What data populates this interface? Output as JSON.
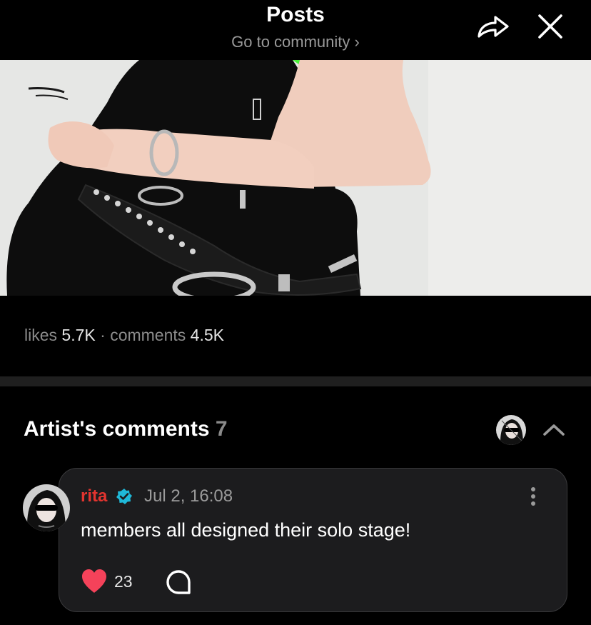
{
  "header": {
    "title": "Posts",
    "subtitle": "Go to community",
    "subtitle_chevron": "›",
    "share_icon": "share-arrow-icon",
    "close_icon": "close-icon"
  },
  "post": {
    "image_alt": "photo of person in black outfit with studded belt",
    "likes_label": "likes",
    "likes_count": "5.7K",
    "separator": "·",
    "comments_label": "comments",
    "comments_count": "4.5K"
  },
  "artist_comments": {
    "title": "Artist's comments",
    "count": "7",
    "collapse_icon": "chevron-up-icon"
  },
  "comment": {
    "author": "rita",
    "verified_icon": "verified-badge-icon",
    "timestamp": "Jul 2, 16:08",
    "text": "members all designed their solo stage!",
    "like_count": "23",
    "like_icon": "heart-icon",
    "reply_icon": "comment-bubble-icon",
    "more_icon": "more-vertical-icon"
  },
  "colors": {
    "background": "#000000",
    "card": "#1c1c1e",
    "author_name": "#e3342f",
    "verified": "#1fb8d8",
    "heart": "#f5425a",
    "muted_text": "#8c8c8c"
  }
}
